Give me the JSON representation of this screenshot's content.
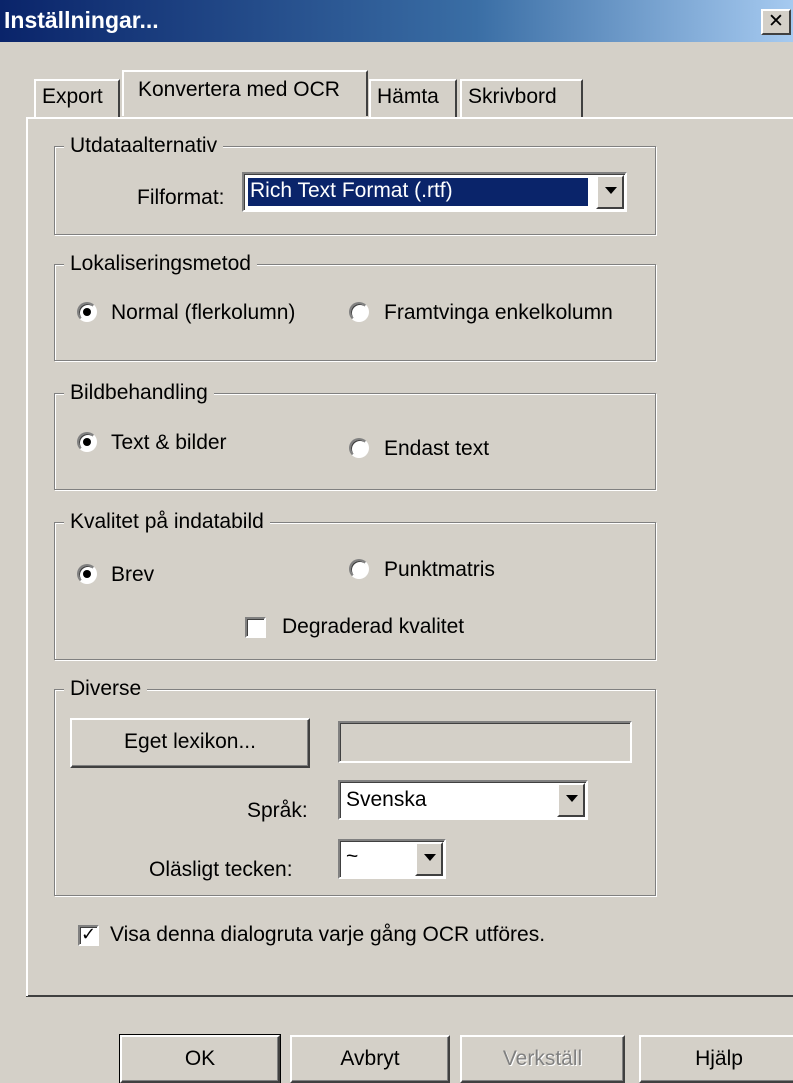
{
  "window": {
    "title": "Inställningar...",
    "close_glyph": "✕"
  },
  "tabs": [
    {
      "label": "Export",
      "active": false
    },
    {
      "label": "Konvertera med OCR",
      "active": true
    },
    {
      "label": "Hämta",
      "active": false
    },
    {
      "label": "Skrivbord",
      "active": false
    }
  ],
  "output": {
    "legend": "Utdataalternativ",
    "format_label": "Filformat:",
    "format_value": "Rich Text Format (.rtf)"
  },
  "layout_method": {
    "legend": "Lokaliseringsmetod",
    "options": [
      {
        "label": "Normal (flerkolumn)",
        "selected": true
      },
      {
        "label": "Framtvinga enkelkolumn",
        "selected": false
      }
    ]
  },
  "image_handling": {
    "legend": "Bildbehandling",
    "options": [
      {
        "label": "Text & bilder",
        "selected": true
      },
      {
        "label": "Endast text",
        "selected": false
      }
    ]
  },
  "input_quality": {
    "legend": "Kvalitet på indatabild",
    "options": [
      {
        "label": "Brev",
        "selected": true
      },
      {
        "label": "Punktmatris",
        "selected": false
      }
    ],
    "degraded_label": "Degraderad kvalitet",
    "degraded_checked": false
  },
  "misc": {
    "legend": "Diverse",
    "lexicon_button": "Eget lexikon...",
    "lexicon_value": "",
    "language_label": "Språk:",
    "language_value": "Svenska",
    "illegible_label": "Oläsligt tecken:",
    "illegible_value": "~"
  },
  "show_dialog": {
    "label": "Visa denna dialogruta varje gång OCR utföres.",
    "checked": true,
    "check_glyph": "✓"
  },
  "buttons": {
    "ok": "OK",
    "cancel": "Avbryt",
    "apply": "Verkställ",
    "help": "Hjälp"
  },
  "colors": {
    "dialog_bg": "#d4d0c8",
    "title_start": "#0a246a",
    "title_end": "#a6caf0",
    "selection": "#0a246a"
  }
}
